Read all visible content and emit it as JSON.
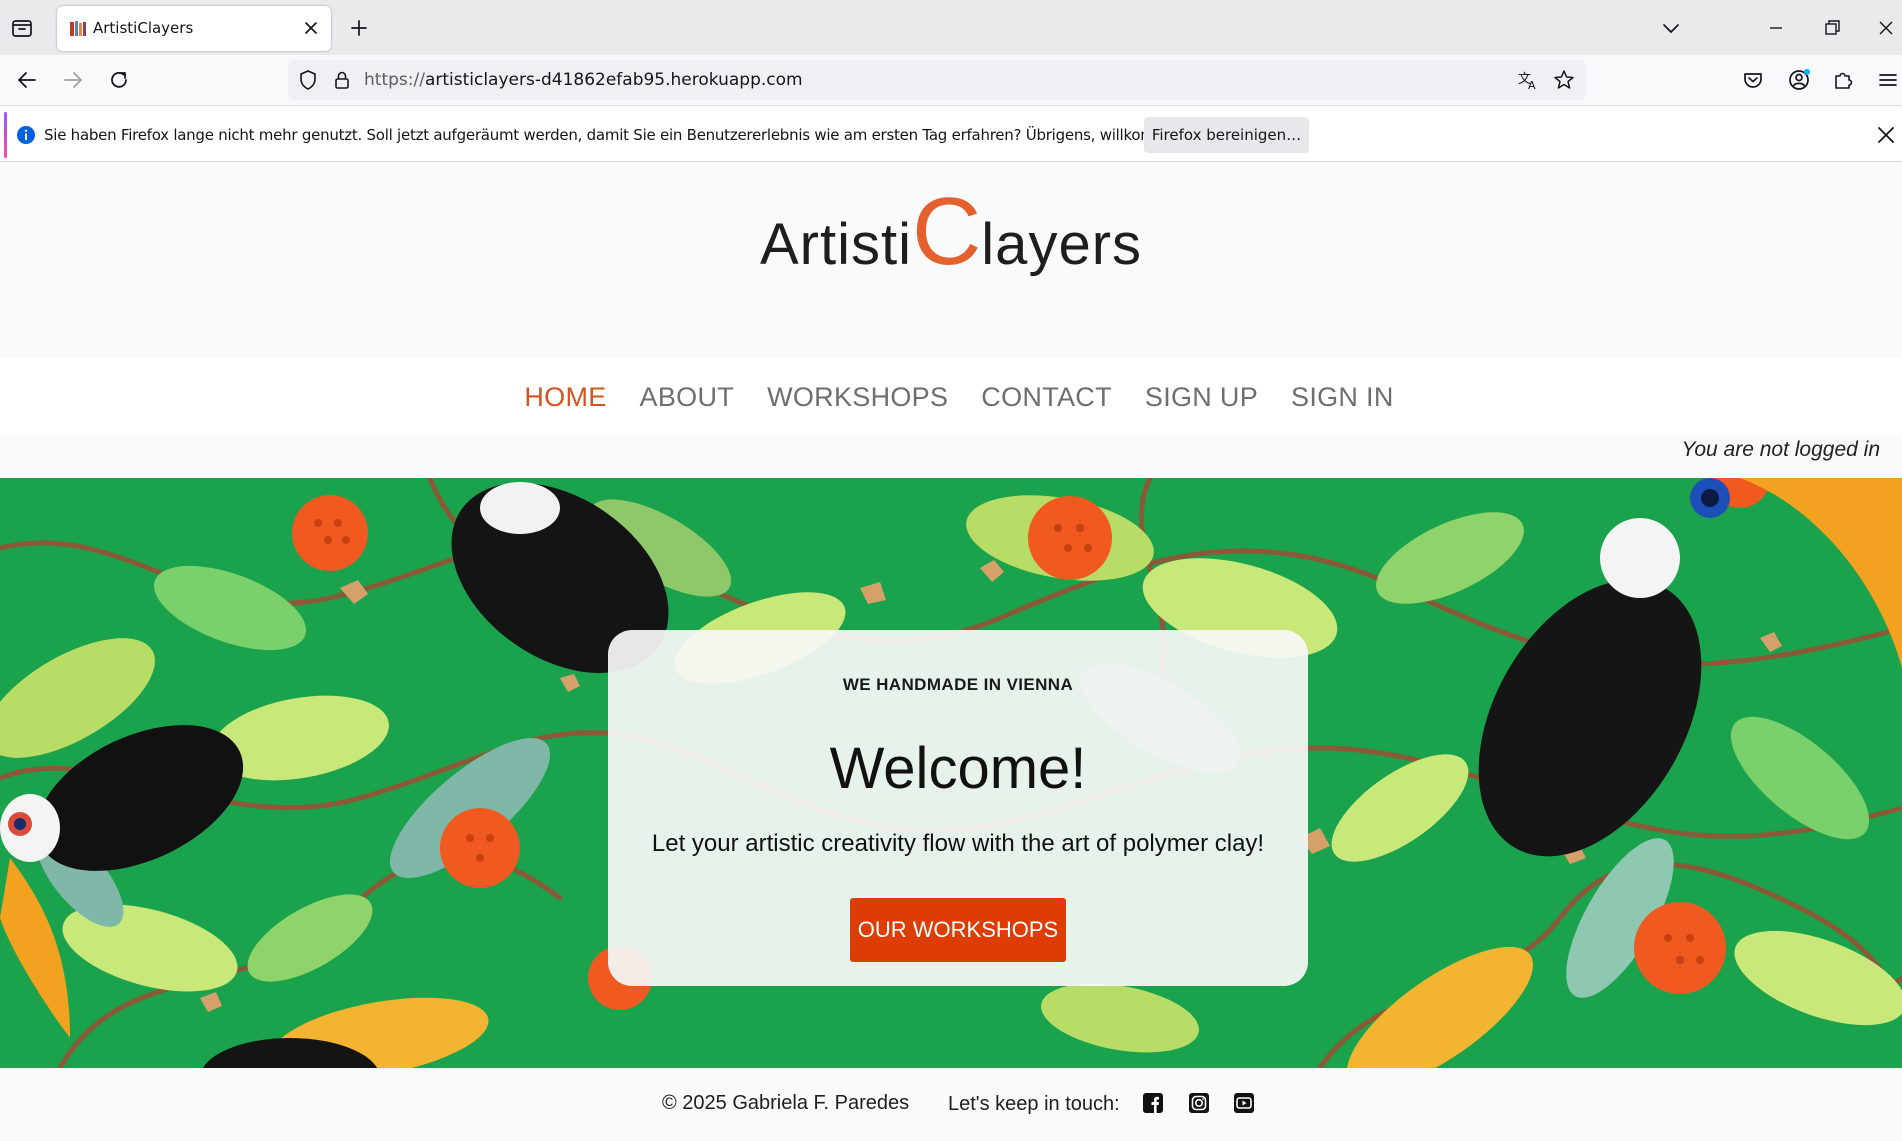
{
  "browser": {
    "tab_title": "ArtistiClayers",
    "url_scheme": "https://",
    "url_host": "artisticlayers-d41862efab95.herokuapp.com",
    "infobar_message": "Sie haben Firefox lange nicht mehr genutzt. Soll jetzt aufgeräumt werden, damit Sie ein Benutzererlebnis wie am ersten Tag erfahren? Übrigens, willkommen zurück!",
    "infobar_button": "Firefox bereinigen…"
  },
  "site": {
    "logo_part1": "Artisti",
    "logo_part2": "C",
    "logo_part3": "layers",
    "nav": [
      {
        "label": "HOME",
        "active": true
      },
      {
        "label": "ABOUT",
        "active": false
      },
      {
        "label": "WORKSHOPS",
        "active": false
      },
      {
        "label": "CONTACT",
        "active": false
      },
      {
        "label": "SIGN UP",
        "active": false
      },
      {
        "label": "SIGN IN",
        "active": false
      }
    ],
    "login_status": "You are not logged in",
    "hero": {
      "eyebrow": "WE HANDMADE IN VIENNA",
      "title": "Welcome!",
      "tagline": "Let your artistic creativity flow with the art of polymer clay!",
      "cta": "OUR WORKSHOPS"
    },
    "footer": {
      "copyright": "© 2025 Gabriela F. Paredes",
      "keep_in_touch": "Let's keep in touch:",
      "social_icons": [
        "facebook-icon",
        "instagram-icon",
        "youtube-icon"
      ]
    }
  },
  "colors": {
    "accent": "#e4602d",
    "nav_active": "#d5531f",
    "cta": "#dd3d05",
    "hero_green": "#19a04a"
  }
}
